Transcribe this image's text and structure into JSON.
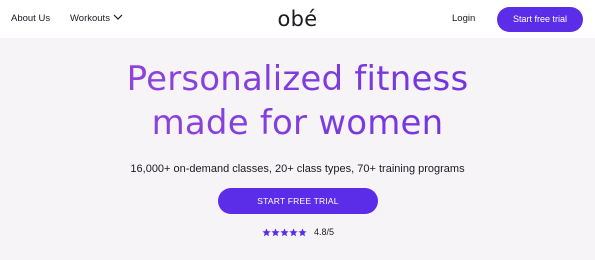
{
  "nav": {
    "about_label": "About Us",
    "workouts_label": "Workouts",
    "workouts_icon": "chevron-down-icon",
    "login_label": "Login",
    "trial_button_label": "Start free trial"
  },
  "brand": {
    "logo_text": "obé"
  },
  "hero": {
    "title_line1": "Personalized fitness",
    "title_line2": "made for women",
    "subtitle": "16,000+ on-demand classes, 20+ class types, 70+ training programs",
    "cta_label": "START FREE TRIAL",
    "rating": {
      "stars": 5,
      "star_icon": "star-icon",
      "value": "4.8/5"
    }
  },
  "colors": {
    "accent": "#5c2de8",
    "title_gradient_start": "#9b4bd8",
    "title_gradient_end": "#6a30e3",
    "background": "#f6f4f7",
    "nav_background": "#ffffff"
  }
}
